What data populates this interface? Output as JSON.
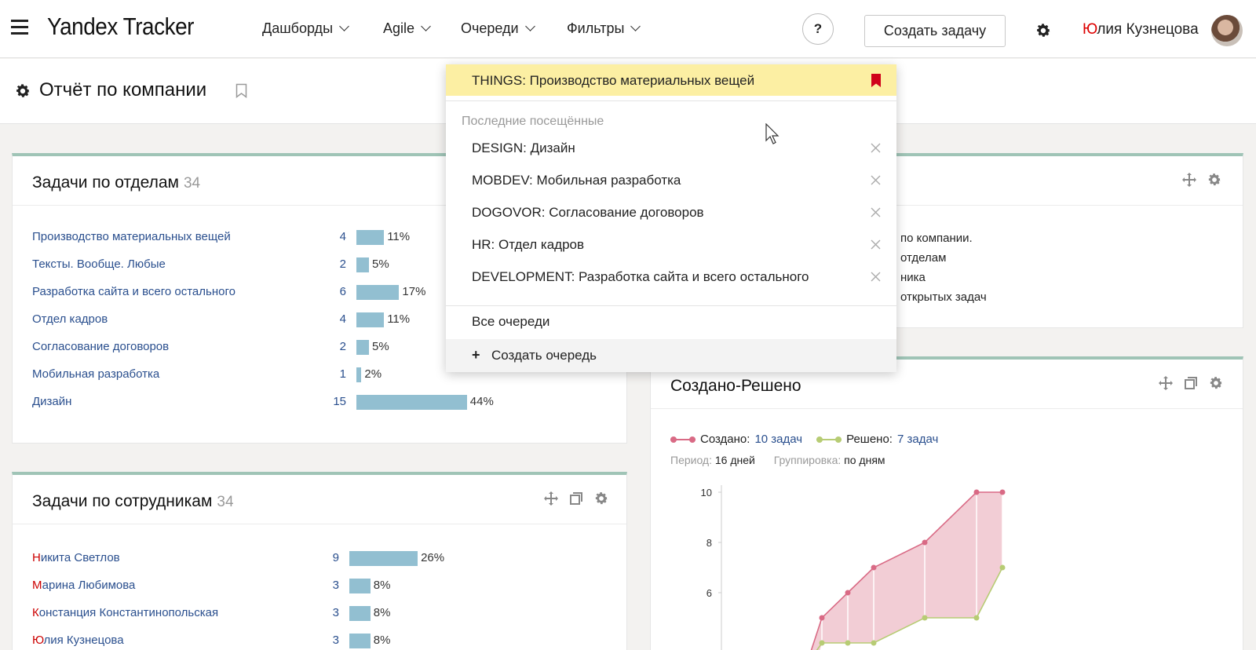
{
  "app": {
    "logo": "Yandex Tracker"
  },
  "nav": [
    {
      "label": "Дашборды"
    },
    {
      "label": "Agile"
    },
    {
      "label": "Очереди"
    },
    {
      "label": "Фильтры"
    }
  ],
  "header": {
    "help_label": "?",
    "create_task_label": "Создать задачу",
    "user_first_letter": "Ю",
    "user_name_rest": "лия Кузнецова"
  },
  "page": {
    "title": "Отчёт по компании"
  },
  "widgets": {
    "departments": {
      "title": "Задачи по отделам",
      "count": "34",
      "rows": [
        {
          "name": "Производство материальных вещей",
          "count": "4",
          "percent": "11%",
          "share": 11
        },
        {
          "name": "Тексты. Вообще. Любые",
          "count": "2",
          "percent": "5%",
          "share": 5
        },
        {
          "name": "Разработка сайта и всего остального",
          "count": "6",
          "percent": "17%",
          "share": 17
        },
        {
          "name": "Отдел кадров",
          "count": "4",
          "percent": "11%",
          "share": 11
        },
        {
          "name": "Согласование договоров",
          "count": "2",
          "percent": "5%",
          "share": 5
        },
        {
          "name": "Мобильная разработка",
          "count": "1",
          "percent": "2%",
          "share": 2
        },
        {
          "name": "Дизайн",
          "count": "15",
          "percent": "44%",
          "share": 44
        }
      ]
    },
    "employees": {
      "title": "Задачи по сотрудникам",
      "count": "34",
      "rows": [
        {
          "first": "Н",
          "rest": "икита Светлов",
          "count": "9",
          "percent": "26%",
          "share": 26
        },
        {
          "first": "М",
          "rest": "арина Любимова",
          "count": "3",
          "percent": "8%",
          "share": 8
        },
        {
          "first": "К",
          "rest": "онстанция Константинопольская",
          "count": "3",
          "percent": "8%",
          "share": 8
        },
        {
          "first": "Ю",
          "rest": "лия Кузнецова",
          "count": "3",
          "percent": "8%",
          "share": 8
        }
      ]
    },
    "info": {
      "lines": [
        "по компании.",
        "отделам",
        "ника",
        "открытых задач"
      ]
    },
    "created_resolved": {
      "title": "Создано-Решено",
      "legend_created_key": "Создано:",
      "legend_created_value": "10 задач",
      "legend_resolved_key": "Решено:",
      "legend_resolved_value": "7 задач",
      "period_key": "Период:",
      "period_value": "16 дней",
      "grouping_key": "Группировка:",
      "grouping_value": "по дням",
      "colors": {
        "created": "#d96a85",
        "resolved": "#b7cc74",
        "fill": "#f2cdd5"
      }
    }
  },
  "chart_data": {
    "type": "area",
    "title": "Создано-Решено",
    "y_ticks": [
      "10",
      "8",
      "6"
    ],
    "series": [
      {
        "name": "Создано",
        "values": [
          5,
          6,
          7,
          8,
          10,
          10
        ]
      },
      {
        "name": "Решено",
        "values": [
          4,
          4,
          4,
          5,
          5,
          7
        ]
      }
    ]
  },
  "dropdown": {
    "favorite": "THINGS: Производство материальных вещей",
    "recent_header": "Последние посещённые",
    "recent": [
      "DESIGN: Дизайн",
      "MOBDEV: Мобильная разработка",
      "DOGOVOR: Согласование договоров",
      "HR: Отдел кадров",
      "DEVELOPMENT: Разработка сайта и всего остального"
    ],
    "all_queues": "Все очереди",
    "create_plus": "+",
    "create_queue": "Создать очередь"
  }
}
